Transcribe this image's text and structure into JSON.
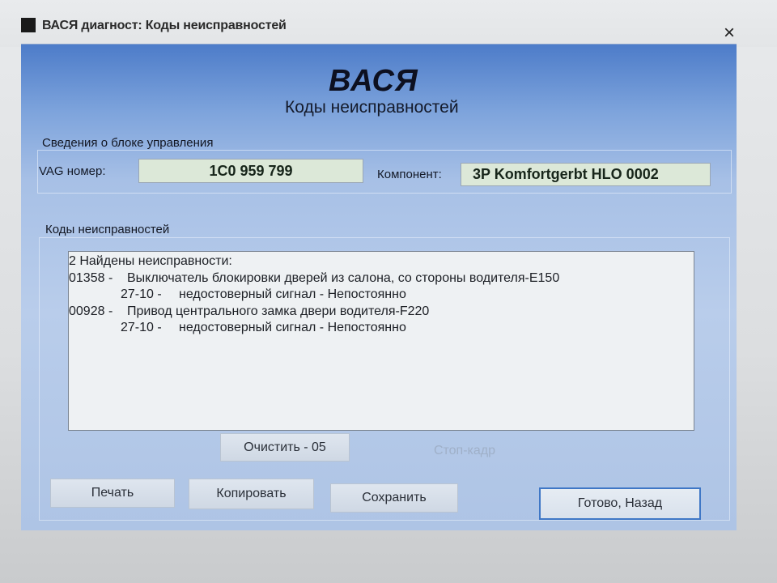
{
  "window": {
    "title": "ВАСЯ диагност: Коды неисправностей",
    "close_glyph": "×"
  },
  "header": {
    "brand": "ВАСЯ",
    "subtitle": "Коды неисправностей"
  },
  "info": {
    "group_title": "Сведения о блоке управления",
    "vag_label": "VAG номер:",
    "vag_value": "1C0 959 799",
    "component_label": "Компонент:",
    "component_value": "3P Komfortgerbt HLO 0002"
  },
  "codes": {
    "group_title": "Коды неисправностей",
    "summary": "2 Найдены неисправности:",
    "items": [
      {
        "code": "01358 -",
        "description": "Выключатель блокировки дверей из салона, со стороны водителя-E150",
        "sub_code": "27-10 -",
        "sub_description": "недостоверный сигнал - Непостоянно"
      },
      {
        "code": "00928 -",
        "description": "Привод центрального замка двери водителя-F220",
        "sub_code": "27-10 -",
        "sub_description": "недостоверный сигнал - Непостоянно"
      }
    ]
  },
  "buttons": {
    "clear": "Очистить - 05",
    "freeze_frame": "Стоп-кадр",
    "print": "Печать",
    "copy": "Копировать",
    "save": "Сохранить",
    "done": "Готово, Назад"
  },
  "colors": {
    "dialog_blue": "#7ea4dc",
    "field_green": "#dce8d8",
    "default_button_border": "#3f77c6"
  }
}
